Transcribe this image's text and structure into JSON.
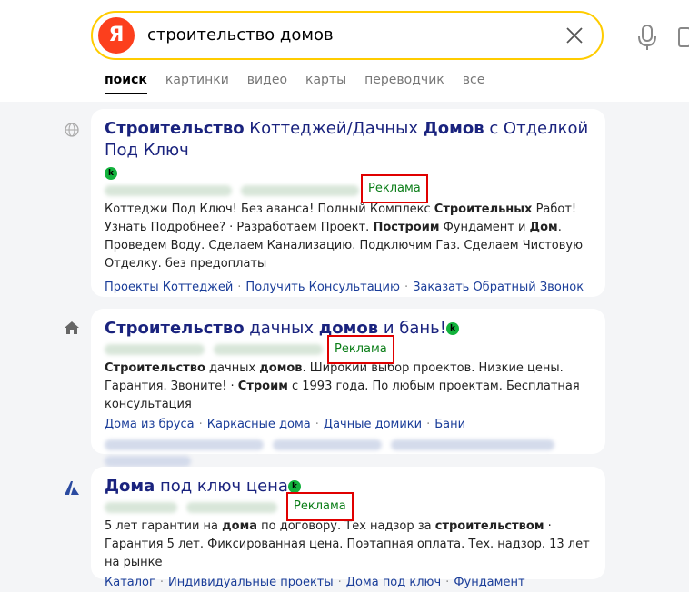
{
  "search": {
    "logo": "Я",
    "query": "строительство домов"
  },
  "tabs": [
    "поиск",
    "картинки",
    "видео",
    "карты",
    "переводчик",
    "все"
  ],
  "results": [
    {
      "title_parts": [
        {
          "text": "Строительство",
          "bold": true
        },
        {
          "text": " Коттеджей/Дачных ",
          "bold": false
        },
        {
          "text": "Домов",
          "bold": true
        },
        {
          "text": " с Отделкой Под Ключ",
          "bold": false
        }
      ],
      "ad_label": "Реклама",
      "snippet_parts": [
        {
          "text": "Коттеджи Под Ключ! Без аванса! Полный Комплекс ",
          "bold": false
        },
        {
          "text": "Строительных",
          "bold": true
        },
        {
          "text": " Работ! Узнать Подробнее? · Разработаем Проект. ",
          "bold": false
        },
        {
          "text": "Построим",
          "bold": true
        },
        {
          "text": " Фундамент и ",
          "bold": false
        },
        {
          "text": "Дом",
          "bold": true
        },
        {
          "text": ". Проведем Воду. Сделаем Канализацию. Подключим Газ. Сделаем Чистовую Отделку. без предоплаты",
          "bold": false
        }
      ],
      "links": [
        "Проекты Коттеджей",
        "Получить Консультацию",
        "Заказать Обратный Звонок"
      ]
    },
    {
      "title_parts": [
        {
          "text": "Строительство",
          "bold": true
        },
        {
          "text": " дачных ",
          "bold": false
        },
        {
          "text": "домов",
          "bold": true
        },
        {
          "text": " и бань!",
          "bold": false
        }
      ],
      "ad_label": "Реклама",
      "snippet_parts": [
        {
          "text": "Строительство",
          "bold": true
        },
        {
          "text": " дачных ",
          "bold": false
        },
        {
          "text": "домов",
          "bold": true
        },
        {
          "text": ". Широкий выбор проектов. Низкие цены. Гарантия. Звоните! · ",
          "bold": false
        },
        {
          "text": "Строим",
          "bold": true
        },
        {
          "text": " с 1993 года. По любым проектам. Бесплатная консультация",
          "bold": false
        }
      ],
      "links": [
        "Дома из бруса",
        "Каркасные дома",
        "Дачные домики",
        "Бани"
      ]
    },
    {
      "title_parts": [
        {
          "text": "Дома",
          "bold": true
        },
        {
          "text": " под ключ цена",
          "bold": false
        }
      ],
      "ad_label": "Реклама",
      "snippet_parts": [
        {
          "text": "5 лет гарантии на ",
          "bold": false
        },
        {
          "text": "дома",
          "bold": true
        },
        {
          "text": " по договору. Тех надзор за ",
          "bold": false
        },
        {
          "text": "строительством",
          "bold": true
        },
        {
          "text": " · Гарантия 5 лет. Фиксированная цена. Поэтапная оплата. Тех. надзор. 13 лет на рынке",
          "bold": false
        }
      ],
      "links": [
        "Каталог",
        "Индивидуальные проекты",
        "Дома под ключ",
        "Фундамент"
      ]
    }
  ],
  "colors": {
    "accent": "#fc3f1d",
    "search_border": "#ffcc00",
    "title": "#1a237e",
    "link": "#1a3d99",
    "ad_green": "#0a7d17",
    "ad_highlight": "#e00000"
  },
  "icons": [
    "globe-icon",
    "house-icon",
    "triangle-logo-icon",
    "mic-icon",
    "clear-icon",
    "verified-badge-icon"
  ]
}
